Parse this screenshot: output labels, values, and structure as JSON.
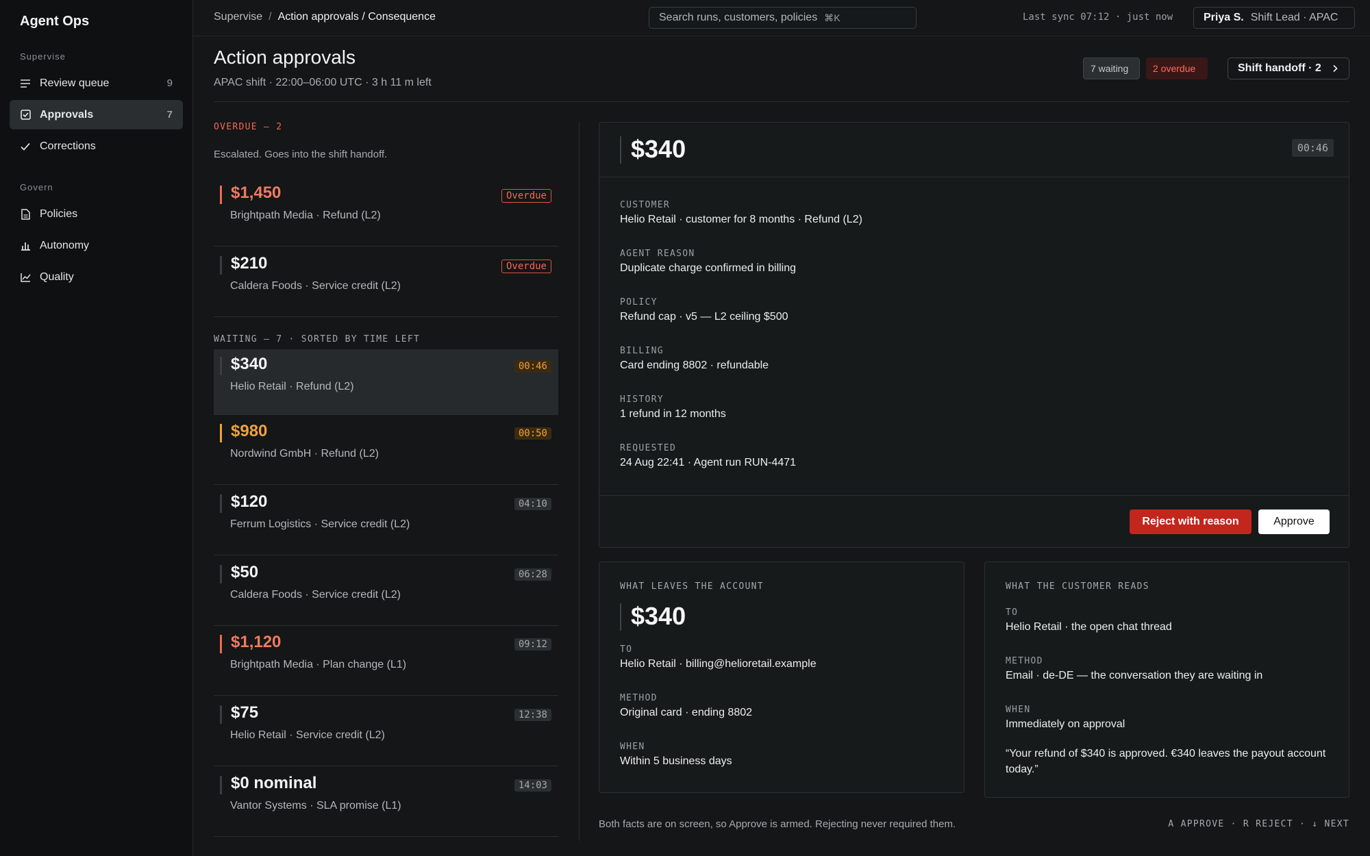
{
  "app": {
    "brand": "Agent Ops"
  },
  "sidebar": {
    "sections": [
      {
        "label": "Supervise"
      },
      {
        "label": "Govern"
      }
    ],
    "items": [
      {
        "label": "Review queue",
        "count": "9",
        "icon": "list-icon"
      },
      {
        "label": "Approvals",
        "count": "7",
        "icon": "checkbox-icon",
        "active": true
      },
      {
        "label": "Corrections",
        "count": "",
        "icon": "check-icon"
      },
      {
        "label": "Policies",
        "count": "",
        "icon": "document-icon"
      },
      {
        "label": "Autonomy",
        "count": "",
        "icon": "bar-chart-icon"
      },
      {
        "label": "Quality",
        "count": "",
        "icon": "line-chart-icon"
      }
    ]
  },
  "topbar": {
    "breadcrumb": {
      "root": "Supervise",
      "separator": "/",
      "current": "Action approvals / Consequence"
    },
    "search": {
      "placeholder": "Search runs, customers, policies",
      "shortcut": "⌘K"
    },
    "sync": "Last sync 07:12 · just now",
    "user": {
      "name": "Priya S.",
      "role": "Shift Lead · APAC"
    }
  },
  "header": {
    "title": "Action approvals",
    "subtitle": "APAC shift · 22:00–06:00 UTC · 3 h 11 m left",
    "waiting_badge": "7 waiting",
    "overdue_badge": "2 overdue",
    "handoff_button": "Shift handoff · 2"
  },
  "queue": {
    "overdue_label": "OVERDUE — 2",
    "overdue_note": "Escalated. Goes into the shift handoff.",
    "overdue": [
      {
        "amount": "$1,450",
        "desc": "Brightpath Media · Refund (L2)",
        "tag": "Overdue"
      },
      {
        "amount": "$210",
        "desc": "Caldera Foods · Service credit (L2)",
        "tag": "Overdue"
      }
    ],
    "waiting_label": "WAITING — 7 · SORTED BY TIME LEFT",
    "waiting": [
      {
        "amount": "$340",
        "desc": "Helio Retail · Refund (L2)",
        "tag": "00:46"
      },
      {
        "amount": "$980",
        "desc": "Nordwind GmbH · Refund (L2)",
        "tag": "00:50"
      },
      {
        "amount": "$120",
        "desc": "Ferrum Logistics · Service credit (L2)",
        "tag": "04:10"
      },
      {
        "amount": "$50",
        "desc": "Caldera Foods · Service credit (L2)",
        "tag": "06:28"
      },
      {
        "amount": "$1,120",
        "desc": "Brightpath Media · Plan change (L1)",
        "tag": "09:12"
      },
      {
        "amount": "$75",
        "desc": "Helio Retail · Service credit (L2)",
        "tag": "12:38"
      },
      {
        "amount": "$0 nominal",
        "desc": "Vantor Systems · SLA promise (L1)",
        "tag": "14:03"
      }
    ]
  },
  "detail": {
    "amount": "$340",
    "timer": "00:46",
    "fields": [
      {
        "key": "CUSTOMER",
        "value": "Helio Retail · customer for 8 months · Refund (L2)"
      },
      {
        "key": "AGENT REASON",
        "value": "Duplicate charge confirmed in billing"
      },
      {
        "key": "POLICY",
        "value": "Refund cap · v5 — L2 ceiling $500"
      },
      {
        "key": "BILLING",
        "value": "Card ending 8802 · refundable"
      },
      {
        "key": "HISTORY",
        "value": "1 refund in 12 months"
      },
      {
        "key": "REQUESTED",
        "value": "24 Aug 22:41 · Agent run RUN-4471"
      }
    ],
    "reject_label": "Reject with reason",
    "approve_label": "Approve"
  },
  "money": {
    "label": "WHAT LEAVES THE ACCOUNT",
    "amount": "$340",
    "fields": [
      {
        "key": "TO",
        "value": "Helio Retail · billing@helioretail.example"
      },
      {
        "key": "METHOD",
        "value": "Original card · ending 8802"
      },
      {
        "key": "WHEN",
        "value": "Within 5 business days"
      }
    ]
  },
  "reads": {
    "label": "WHAT THE CUSTOMER READS",
    "fields": [
      {
        "key": "TO",
        "value": "Helio Retail · the open chat thread"
      },
      {
        "key": "METHOD",
        "value": "Email · de-DE — the conversation they are waiting in"
      },
      {
        "key": "WHEN",
        "value": "Immediately on approval"
      }
    ],
    "quote": "“Your refund of $340 is approved. €340 leaves the payout account today.”"
  },
  "footer": {
    "note": "Both facts are on screen, so Approve is armed. Rejecting never required them.",
    "shortcuts": "A APPROVE · R REJECT · ↓ NEXT"
  },
  "colors": {
    "accent_red": "#c2261d",
    "overdue_text": "#f06a53",
    "warning": "#f0a23b"
  }
}
